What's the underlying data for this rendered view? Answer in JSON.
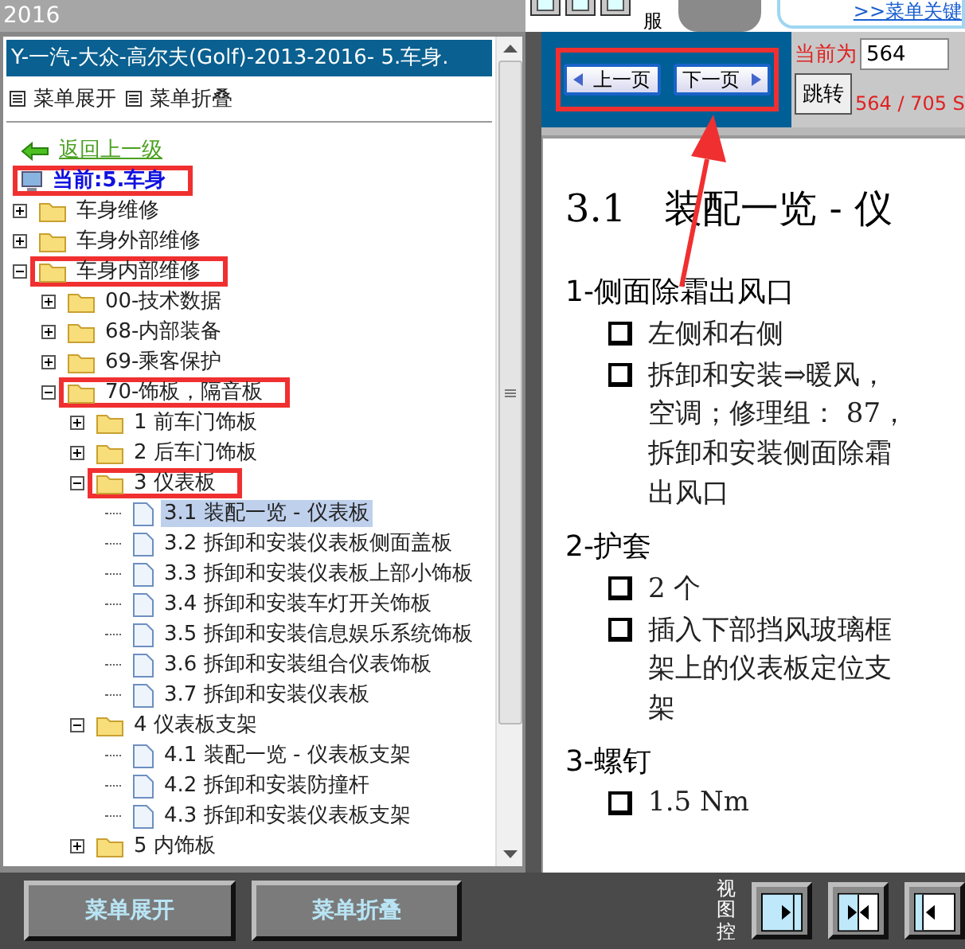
{
  "top_bar": {
    "title": "2016",
    "side_text": "服",
    "link": ">>菜单关键"
  },
  "left_panel": {
    "title": "Y-一汽-大众-高尔夫(Golf)-2013-2016- 5.车身.",
    "menu_actions": [
      "菜单展开",
      "菜单折叠"
    ]
  },
  "tree": [
    {
      "kind": "back",
      "label": "返回上一级",
      "highlighted": false
    },
    {
      "kind": "current",
      "label": "当前:5.车身",
      "highlighted": true
    },
    {
      "kind": "folder",
      "label": "车身维修",
      "expanded": false,
      "selected": false,
      "highlighted": false
    },
    {
      "kind": "folder",
      "label": "车身外部维修",
      "expanded": false,
      "selected": false,
      "highlighted": false
    },
    {
      "kind": "folder",
      "label": "车身内部维修",
      "expanded": true,
      "selected": false,
      "highlighted": true,
      "children": [
        {
          "kind": "folder",
          "label": "00-技术数据",
          "expanded": false,
          "selected": false,
          "highlighted": false
        },
        {
          "kind": "folder",
          "label": "68-内部装备",
          "expanded": false,
          "selected": false,
          "highlighted": false
        },
        {
          "kind": "folder",
          "label": "69-乘客保护",
          "expanded": false,
          "selected": false,
          "highlighted": false
        },
        {
          "kind": "folder",
          "label": "70-饰板，隔音板",
          "expanded": true,
          "selected": false,
          "highlighted": true,
          "children": [
            {
              "kind": "folder",
              "label": "1 前车门饰板",
              "expanded": false,
              "selected": false,
              "highlighted": false
            },
            {
              "kind": "folder",
              "label": "2 后车门饰板",
              "expanded": false,
              "selected": false,
              "highlighted": false
            },
            {
              "kind": "folder",
              "label": "3 仪表板",
              "expanded": true,
              "selected": false,
              "highlighted": true,
              "children": [
                {
                  "kind": "page",
                  "label": "3.1 装配一览 - 仪表板",
                  "selected": true,
                  "highlighted": false
                },
                {
                  "kind": "page",
                  "label": "3.2 拆卸和安装仪表板侧面盖板",
                  "selected": false,
                  "highlighted": false
                },
                {
                  "kind": "page",
                  "label": "3.3 拆卸和安装仪表板上部小饰板",
                  "selected": false,
                  "highlighted": false
                },
                {
                  "kind": "page",
                  "label": "3.4 拆卸和安装车灯开关饰板",
                  "selected": false,
                  "highlighted": false
                },
                {
                  "kind": "page",
                  "label": "3.5 拆卸和安装信息娱乐系统饰板",
                  "selected": false,
                  "highlighted": false
                },
                {
                  "kind": "page",
                  "label": "3.6 拆卸和安装组合仪表饰板",
                  "selected": false,
                  "highlighted": false
                },
                {
                  "kind": "page",
                  "label": "3.7 拆卸和安装仪表板",
                  "selected": false,
                  "highlighted": false
                }
              ]
            },
            {
              "kind": "folder",
              "label": "4 仪表板支架",
              "expanded": true,
              "selected": false,
              "highlighted": false,
              "children": [
                {
                  "kind": "page",
                  "label": "4.1 装配一览 - 仪表板支架",
                  "selected": false,
                  "highlighted": false
                },
                {
                  "kind": "page",
                  "label": "4.2 拆卸和安装防撞杆",
                  "selected": false,
                  "highlighted": false
                },
                {
                  "kind": "page",
                  "label": "4.3 拆卸和安装仪表板支架",
                  "selected": false,
                  "highlighted": false
                }
              ]
            },
            {
              "kind": "folder",
              "label": "5 内饰板",
              "expanded": false,
              "selected": false,
              "highlighted": false
            }
          ]
        }
      ]
    }
  ],
  "bottom_buttons": [
    "菜单展开",
    "菜单折叠"
  ],
  "view_control": {
    "label": "视图控",
    "buttons": [
      {
        "kind": "right"
      },
      {
        "kind": "both"
      },
      {
        "kind": "left"
      }
    ]
  },
  "pager": {
    "prev": "上一页",
    "next": "下一页",
    "current_label": "当前为",
    "page_value": "564",
    "go": "跳转",
    "page_count": "564 / 705 S"
  },
  "document": [
    {
      "kind": "heading",
      "text": "3.1　装配一览 - 仪"
    },
    {
      "kind": "item",
      "text": "1-侧面除霜出风口"
    },
    {
      "kind": "bullet",
      "text": "左侧和右侧"
    },
    {
      "kind": "bullet",
      "text": "拆卸和安装⇒暖风，"
    },
    {
      "kind": "continuation",
      "text": "空调；修理组： 87，"
    },
    {
      "kind": "continuation",
      "text": "拆卸和安装侧面除霜"
    },
    {
      "kind": "continuation",
      "text": "出风口"
    },
    {
      "kind": "item",
      "text": "2-护套"
    },
    {
      "kind": "bullet",
      "text": "2 个"
    },
    {
      "kind": "bullet",
      "text": "插入下部挡风玻璃框"
    },
    {
      "kind": "continuation",
      "text": "架上的仪表板定位支"
    },
    {
      "kind": "continuation",
      "text": "架"
    },
    {
      "kind": "item",
      "text": "3-螺钉"
    },
    {
      "kind": "bullet",
      "text": "1.5 Nm"
    }
  ]
}
